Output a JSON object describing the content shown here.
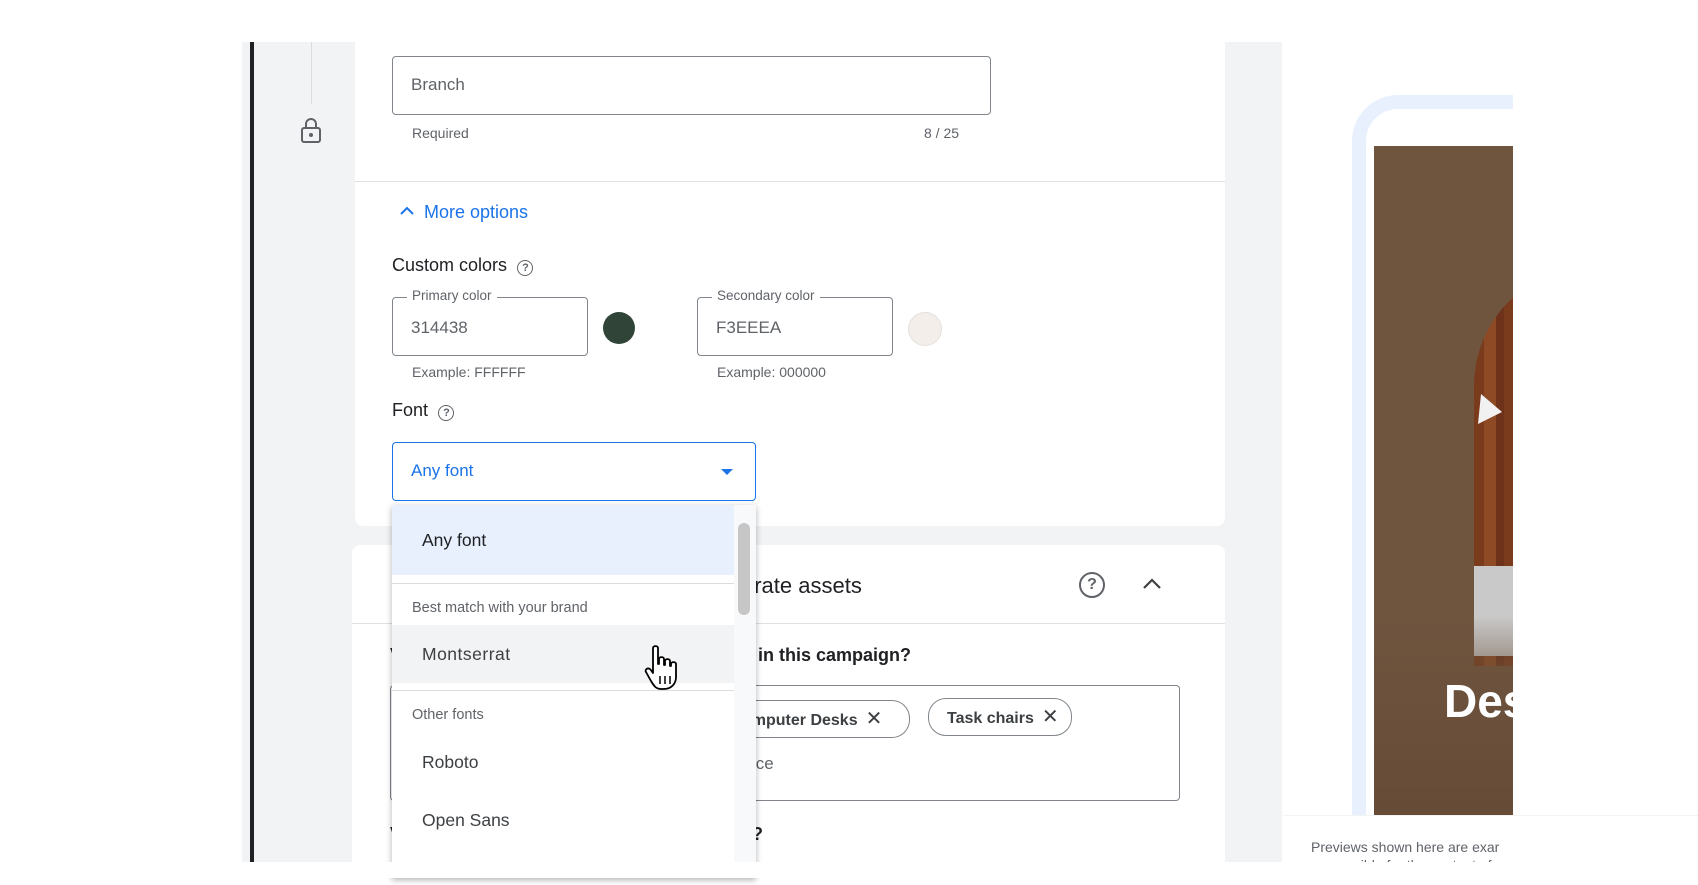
{
  "brand_field": {
    "value": "Branch",
    "helper": "Required",
    "counter": "8 / 25"
  },
  "more_options": {
    "label": "More options",
    "custom_colors": {
      "label": "Custom colors",
      "primary": {
        "label": "Primary color",
        "value": "314438",
        "example": "Example: FFFFFF",
        "swatch": "#314438"
      },
      "secondary": {
        "label": "Secondary color",
        "value": "F3EEEA",
        "example": "Example: 000000",
        "swatch": "#F3EEEA"
      }
    },
    "font": {
      "label": "Font",
      "selected": "Any font"
    }
  },
  "font_menu": {
    "items": [
      {
        "label": "Any font",
        "selected": true
      }
    ],
    "best_match_header": "Best match with your brand",
    "best_match": [
      "Montserrat"
    ],
    "other_header": "Other fonts",
    "other": [
      "Roboto",
      "Open Sans"
    ]
  },
  "generate_section": {
    "title_fragment": "erate assets",
    "question_1_fragment": "g in this campaign?",
    "question_1_stub": "V",
    "chips": [
      "omputer Desks",
      "Task chairs"
    ],
    "input_fragment": "ice",
    "question_2_fragment": "e?",
    "question_2_stub": "V"
  },
  "preview": {
    "headline_fragment": "Des",
    "disclaimer_line1": "Previews shown here are exar",
    "disclaimer_line2": "responsible for the content of"
  },
  "colors": {
    "accent": "#1a73e8",
    "primary_swatch": "#314438",
    "secondary_swatch": "#F3EEEA"
  }
}
